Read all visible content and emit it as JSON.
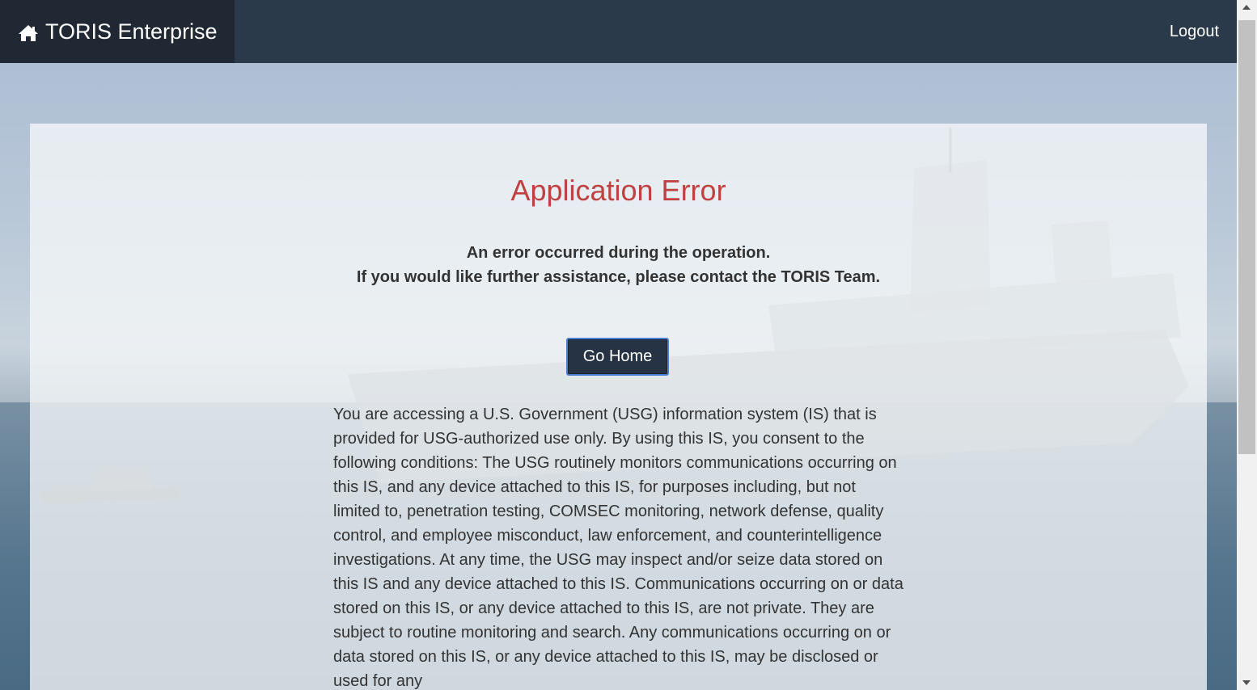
{
  "navbar": {
    "brand_label": "TORIS Enterprise",
    "brand_icon": "home-icon",
    "logout_label": "Logout",
    "background_color": "#2b3a4a",
    "brand_background_color": "#1f2833"
  },
  "main": {
    "title": "Application Error",
    "title_color": "#c0413f",
    "message_line1": "An error occurred during the operation.",
    "message_line2": "If you would like further assistance, please contact the TORIS Team.",
    "go_home_label": "Go Home",
    "notice_text": "You are accessing a U.S. Government (USG) information system (IS) that is provided for USG-authorized use only. By using this IS, you consent to the following conditions: The USG routinely monitors communications occurring on this IS, and any device attached to this IS, for purposes including, but not limited to, penetration testing, COMSEC monitoring, network defense, quality control, and employee misconduct, law enforcement, and counterintelligence investigations. At any time, the USG may inspect and/or seize data stored on this IS and any device attached to this IS. Communications occurring on or data stored on this IS, or any device attached to this IS, are not private. They are subject to routine monitoring and search. Any communications occurring on or data stored on this IS, or any device attached to this IS, may be disclosed or used for any"
  }
}
